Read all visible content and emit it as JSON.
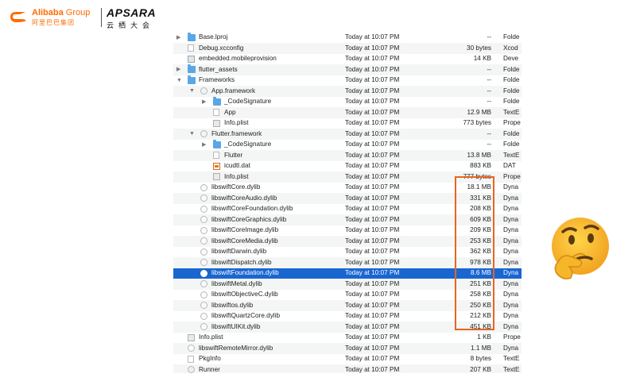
{
  "header": {
    "alibaba_name": "Alibaba",
    "alibaba_group": " Group",
    "alibaba_cn": "阿里巴巴集团",
    "apsara_name": "APSARA",
    "apsara_cn": "云栖大会"
  },
  "files": [
    {
      "name": "Base.lproj",
      "date": "Today at 10:07 PM",
      "size": "--",
      "kind": "Folde",
      "indent": 0,
      "arrow": "▶",
      "icon": "folder"
    },
    {
      "name": "Debug.xcconfig",
      "date": "Today at 10:07 PM",
      "size": "30 bytes",
      "kind": "Xcod",
      "indent": 0,
      "arrow": "",
      "icon": "doc"
    },
    {
      "name": "embedded.mobileprovision",
      "date": "Today at 10:07 PM",
      "size": "14 KB",
      "kind": "Deve",
      "indent": 0,
      "arrow": "",
      "icon": "prov"
    },
    {
      "name": "flutter_assets",
      "date": "Today at 10:07 PM",
      "size": "--",
      "kind": "Folde",
      "indent": 0,
      "arrow": "▶",
      "icon": "folder"
    },
    {
      "name": "Frameworks",
      "date": "Today at 10:07 PM",
      "size": "--",
      "kind": "Folde",
      "indent": 0,
      "arrow": "▼",
      "icon": "folder"
    },
    {
      "name": "App.framework",
      "date": "Today at 10:07 PM",
      "size": "--",
      "kind": "Folde",
      "indent": 1,
      "arrow": "▼",
      "icon": "fw"
    },
    {
      "name": "_CodeSignature",
      "date": "Today at 10:07 PM",
      "size": "--",
      "kind": "Folde",
      "indent": 2,
      "arrow": "▶",
      "icon": "folder"
    },
    {
      "name": "App",
      "date": "Today at 10:07 PM",
      "size": "12.9 MB",
      "kind": "TextE",
      "indent": 2,
      "arrow": "",
      "icon": "doc"
    },
    {
      "name": "Info.plist",
      "date": "Today at 10:07 PM",
      "size": "773 bytes",
      "kind": "Prope",
      "indent": 2,
      "arrow": "",
      "icon": "plist"
    },
    {
      "name": "Flutter.framework",
      "date": "Today at 10:07 PM",
      "size": "--",
      "kind": "Folde",
      "indent": 1,
      "arrow": "▼",
      "icon": "fw"
    },
    {
      "name": "_CodeSignature",
      "date": "Today at 10:07 PM",
      "size": "--",
      "kind": "Folde",
      "indent": 2,
      "arrow": "▶",
      "icon": "folder"
    },
    {
      "name": "Flutter",
      "date": "Today at 10:07 PM",
      "size": "13.8 MB",
      "kind": "TextE",
      "indent": 2,
      "arrow": "",
      "icon": "doc"
    },
    {
      "name": "icudtl.dat",
      "date": "Today at 10:07 PM",
      "size": "883 KB",
      "kind": "DAT",
      "indent": 2,
      "arrow": "",
      "icon": "dat"
    },
    {
      "name": "Info.plist",
      "date": "Today at 10:07 PM",
      "size": "777 bytes",
      "kind": "Prope",
      "indent": 2,
      "arrow": "",
      "icon": "plist"
    },
    {
      "name": "libswiftCore.dylib",
      "date": "Today at 10:07 PM",
      "size": "18.1 MB",
      "kind": "Dyna",
      "indent": 1,
      "arrow": "",
      "icon": "lib"
    },
    {
      "name": "libswiftCoreAudio.dylib",
      "date": "Today at 10:07 PM",
      "size": "331 KB",
      "kind": "Dyna",
      "indent": 1,
      "arrow": "",
      "icon": "lib"
    },
    {
      "name": "libswiftCoreFoundation.dylib",
      "date": "Today at 10:07 PM",
      "size": "208 KB",
      "kind": "Dyna",
      "indent": 1,
      "arrow": "",
      "icon": "lib"
    },
    {
      "name": "libswiftCoreGraphics.dylib",
      "date": "Today at 10:07 PM",
      "size": "609 KB",
      "kind": "Dyna",
      "indent": 1,
      "arrow": "",
      "icon": "lib"
    },
    {
      "name": "libswiftCoreImage.dylib",
      "date": "Today at 10:07 PM",
      "size": "209 KB",
      "kind": "Dyna",
      "indent": 1,
      "arrow": "",
      "icon": "lib"
    },
    {
      "name": "libswiftCoreMedia.dylib",
      "date": "Today at 10:07 PM",
      "size": "253 KB",
      "kind": "Dyna",
      "indent": 1,
      "arrow": "",
      "icon": "lib"
    },
    {
      "name": "libswiftDarwin.dylib",
      "date": "Today at 10:07 PM",
      "size": "362 KB",
      "kind": "Dyna",
      "indent": 1,
      "arrow": "",
      "icon": "lib"
    },
    {
      "name": "libswiftDispatch.dylib",
      "date": "Today at 10:07 PM",
      "size": "978 KB",
      "kind": "Dyna",
      "indent": 1,
      "arrow": "",
      "icon": "lib"
    },
    {
      "name": "libswiftFoundation.dylib",
      "date": "Today at 10:07 PM",
      "size": "8.6 MB",
      "kind": "Dyna",
      "indent": 1,
      "arrow": "",
      "icon": "lib",
      "selected": true
    },
    {
      "name": "libswiftMetal.dylib",
      "date": "Today at 10:07 PM",
      "size": "251 KB",
      "kind": "Dyna",
      "indent": 1,
      "arrow": "",
      "icon": "lib"
    },
    {
      "name": "libswiftObjectiveC.dylib",
      "date": "Today at 10:07 PM",
      "size": "258 KB",
      "kind": "Dyna",
      "indent": 1,
      "arrow": "",
      "icon": "lib"
    },
    {
      "name": "libswiftos.dylib",
      "date": "Today at 10:07 PM",
      "size": "250 KB",
      "kind": "Dyna",
      "indent": 1,
      "arrow": "",
      "icon": "lib"
    },
    {
      "name": "libswiftQuartzCore.dylib",
      "date": "Today at 10:07 PM",
      "size": "212 KB",
      "kind": "Dyna",
      "indent": 1,
      "arrow": "",
      "icon": "lib"
    },
    {
      "name": "libswiftUIKit.dylib",
      "date": "Today at 10:07 PM",
      "size": "451 KB",
      "kind": "Dyna",
      "indent": 1,
      "arrow": "",
      "icon": "lib"
    },
    {
      "name": "Info.plist",
      "date": "Today at 10:07 PM",
      "size": "1 KB",
      "kind": "Prope",
      "indent": 0,
      "arrow": "",
      "icon": "plist"
    },
    {
      "name": "libswiftRemoteMirror.dylib",
      "date": "Today at 10:07 PM",
      "size": "1.1 MB",
      "kind": "Dyna",
      "indent": 0,
      "arrow": "",
      "icon": "lib"
    },
    {
      "name": "PkgInfo",
      "date": "Today at 10:07 PM",
      "size": "8 bytes",
      "kind": "TextE",
      "indent": 0,
      "arrow": "",
      "icon": "doc"
    },
    {
      "name": "Runner",
      "date": "Today at 10:07 PM",
      "size": "207 KB",
      "kind": "TextE",
      "indent": 0,
      "arrow": "",
      "icon": "exe"
    }
  ],
  "colors": {
    "selection": "#1a66d1",
    "highlight_box": "#e8651f",
    "brand": "#ff6a00"
  },
  "decor": {
    "emoji": "thinking-face-icon"
  }
}
